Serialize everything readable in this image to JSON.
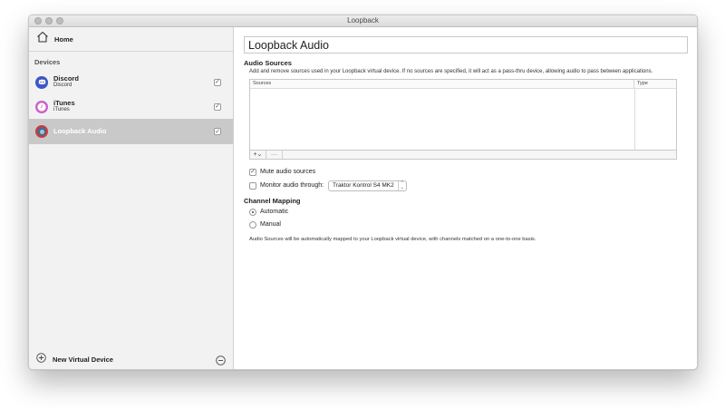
{
  "window": {
    "title": "Loopback"
  },
  "sidebar": {
    "home_label": "Home",
    "devices_heading": "Devices",
    "devices": [
      {
        "name": "Discord",
        "subtitle": "Discord",
        "icon": "discord-icon",
        "checked": true,
        "selected": false
      },
      {
        "name": "iTunes",
        "subtitle": "iTunes",
        "icon": "itunes-icon",
        "checked": true,
        "selected": false
      },
      {
        "name": "Loopback Audio",
        "subtitle": "",
        "icon": "loopback-icon",
        "checked": true,
        "selected": true
      }
    ],
    "new_device_label": "New Virtual Device"
  },
  "main": {
    "device_name": "Loopback Audio",
    "audio_sources": {
      "heading": "Audio Sources",
      "description": "Add and remove sources used in your Loopback virtual device. If no sources are specified, it will act as a pass-thru device, allowing audio to pass between applications.",
      "columns": [
        "Sources",
        "Type"
      ],
      "add_button": "+⌄",
      "remove_button": "—"
    },
    "mute_label": "Mute audio sources",
    "mute_checked": true,
    "monitor_label": "Monitor audio through:",
    "monitor_checked": false,
    "monitor_device": "Traktor Kontrol S4 MK2",
    "channel_mapping": {
      "heading": "Channel Mapping",
      "options": [
        "Automatic",
        "Manual"
      ],
      "selected": "Automatic",
      "note": "Audio Sources will be automatically mapped to your Loopback virtual device, with channels matched on a one-to-one basis."
    }
  },
  "colors": {
    "discord": "#3d57c4",
    "sidebar_bg": "#f2f2f2",
    "selected_row": "#c9c9c9",
    "loopback_ring": "#d23a3a"
  }
}
